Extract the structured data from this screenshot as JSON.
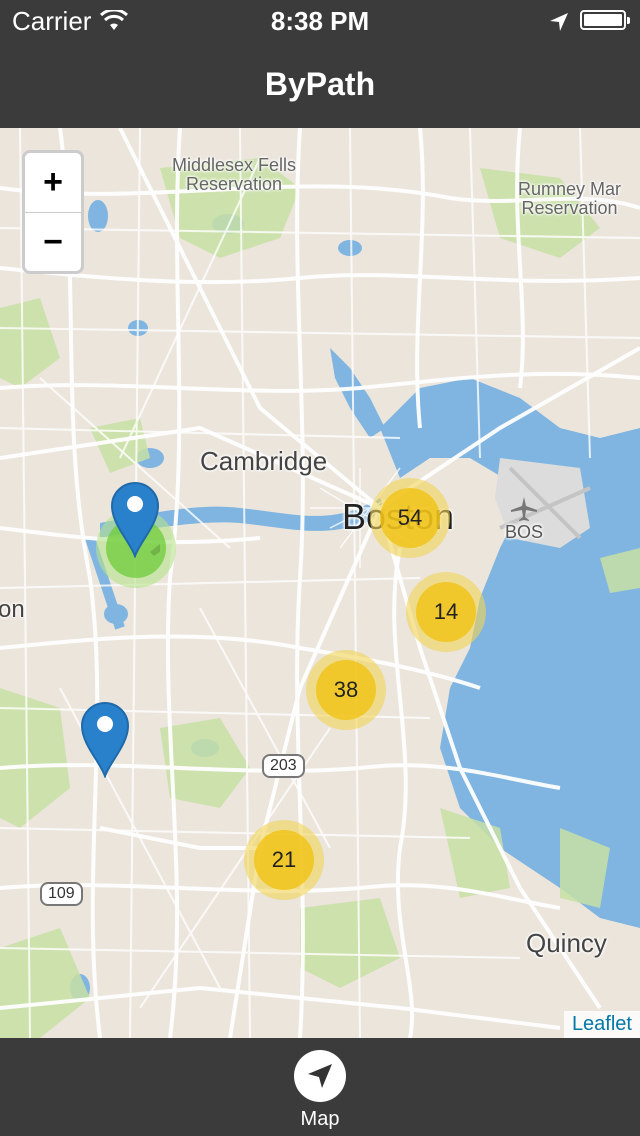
{
  "status_bar": {
    "carrier": "Carrier",
    "time": "8:38 PM"
  },
  "nav": {
    "title": "ByPath"
  },
  "map": {
    "labels": {
      "fells_line1": "Middlesex Fells",
      "fells_line2": "Reservation",
      "rumney_line1": "Rumney Mar",
      "rumney_line2": "Reservation",
      "cambridge": "Cambridge",
      "boston": "Boston",
      "bos": "BOS",
      "partial_city": "on",
      "quincy": "Quincy"
    },
    "route_shields": [
      "203",
      "109"
    ],
    "zoom": {
      "in_label": "+",
      "out_label": "−"
    },
    "clusters": [
      {
        "count": "54",
        "color": "#f0c20c"
      },
      {
        "count": "14",
        "color": "#f0c20c"
      },
      {
        "count": "38",
        "color": "#f0c20c"
      },
      {
        "count": "21",
        "color": "#f0c20c"
      }
    ],
    "green_cluster_color": "#6ecc39",
    "marker_color": "#2a81cb",
    "attribution": "Leaflet"
  },
  "tab_bar": {
    "items": [
      {
        "label": "Map",
        "icon": "navigation-arrow-icon"
      }
    ]
  }
}
